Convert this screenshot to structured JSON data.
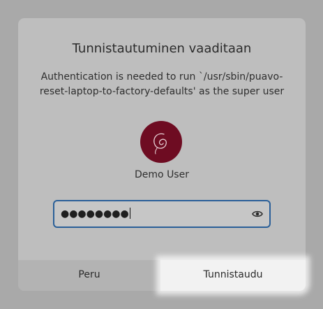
{
  "dialog": {
    "title": "Tunnistautuminen vaaditaan",
    "message": "Authentication is needed to run `/usr/sbin/puavo-reset-laptop-to-factory-defaults' as the super user",
    "user": {
      "name": "Demo User",
      "avatar_icon": "debian-swirl-icon",
      "avatar_color": "#6e0c22"
    },
    "password": {
      "masked_value": "●●●●●●●●",
      "show_password_icon": "eye-icon",
      "focus_color": "#2a5f98"
    },
    "buttons": {
      "cancel_label": "Peru",
      "authenticate_label": "Tunnistaudu"
    }
  }
}
